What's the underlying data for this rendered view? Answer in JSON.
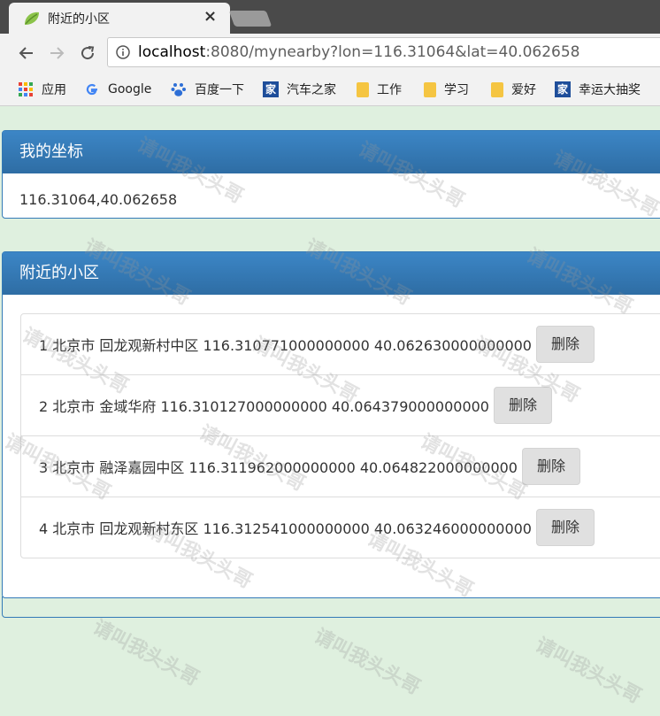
{
  "browser": {
    "tab_title": "附近的小区",
    "tab_close": "×",
    "url_host": "localhost",
    "url_rest": ":8080/mynearby?lon=116.31064&lat=40.062658",
    "bookmarks": [
      {
        "label": "应用",
        "icon": "apps-grid-icon"
      },
      {
        "label": "Google",
        "icon": "google-icon"
      },
      {
        "label": "百度一下",
        "icon": "baidu-paw-icon"
      },
      {
        "label": "汽车之家",
        "icon": "autohome-icon"
      },
      {
        "label": "工作",
        "icon": "folder-icon"
      },
      {
        "label": "学习",
        "icon": "folder-icon"
      },
      {
        "label": "爱好",
        "icon": "folder-icon"
      },
      {
        "label": "幸运大抽奖",
        "icon": "autohome-icon"
      }
    ],
    "jia_glyph": "家"
  },
  "my_location": {
    "heading": "我的坐标",
    "value": "116.31064,40.062658"
  },
  "nearby": {
    "heading": "附近的小区",
    "delete_label": "删除",
    "items": [
      {
        "text": "1 北京市 回龙观新村中区 116.310771000000000 40.062630000000000"
      },
      {
        "text": "2 北京市 金域华府 116.310127000000000 40.064379000000000"
      },
      {
        "text": "3 北京市 融泽嘉园中区 116.311962000000000 40.064822000000000"
      },
      {
        "text": "4 北京市 回龙观新村东区 116.312541000000000 40.063246000000000"
      }
    ]
  },
  "watermark": {
    "text": "请叫我头头哥"
  },
  "colors": {
    "panel_header": "#337ab7",
    "page_bg": "#dff0df",
    "button_bg": "#e0e0e0"
  }
}
